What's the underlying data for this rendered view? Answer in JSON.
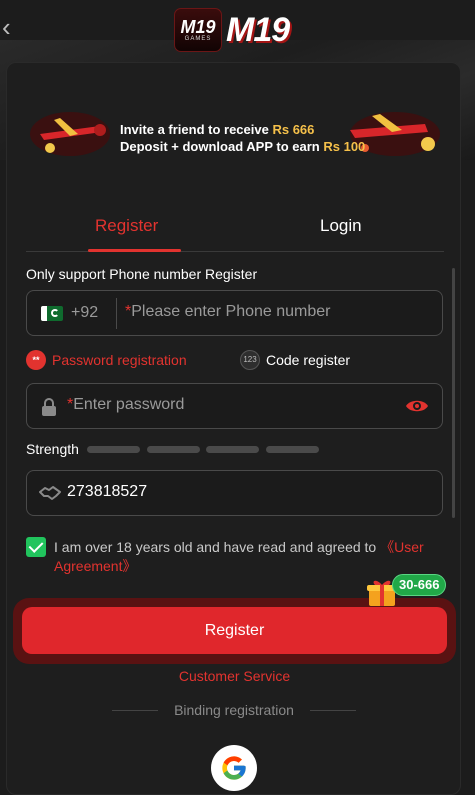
{
  "header": {
    "logo_badge_top": "M19",
    "logo_badge_sub": "GAMES",
    "logo_text": "M19"
  },
  "banner": {
    "line1_text": "Invite a friend to receive",
    "line1_amount": "Rs 666",
    "line2_text": "Deposit + download APP to earn",
    "line2_amount": "Rs 100",
    "art_caption": "Aviator"
  },
  "tabs": {
    "register": "Register",
    "login": "Login"
  },
  "form": {
    "support_label": "Only support Phone number Register",
    "country_code": "+92",
    "required_mark": "*",
    "phone_placeholder": "Please enter Phone number",
    "password_mode_icon": "**",
    "password_mode_label": "Password registration",
    "code_mode_icon": "123",
    "code_mode_label": "Code register",
    "password_placeholder": "Enter password",
    "strength_label": "Strength",
    "invite_code_value": "273818527",
    "agree_text": "I am over 18 years old and have read and agreed to",
    "agree_link": "《User Agreement》",
    "register_button": "Register",
    "gift_badge": "30-666",
    "customer_service": "Customer Service",
    "binding_label": "Binding registration"
  },
  "colors": {
    "accent": "#e2332f",
    "check": "#21c45d",
    "badge": "#21a848",
    "background": "#1c1c1c"
  },
  "icons": [
    "back-chevron-icon",
    "pakistan-flag-icon",
    "lock-icon",
    "eye-icon",
    "handshake-icon",
    "checkbox-icon",
    "gift-icon",
    "google-icon"
  ]
}
